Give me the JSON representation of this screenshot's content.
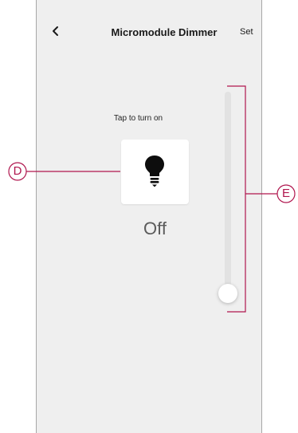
{
  "header": {
    "back_icon": "chevron-left-icon",
    "title": "Micromodule Dimmer",
    "set_label": "Set"
  },
  "control": {
    "hint": "Tap to turn on",
    "bulb_icon": "lightbulb-icon",
    "state": "Off"
  },
  "slider": {
    "level_percent": 0
  },
  "callouts": {
    "d": "D",
    "e": "E",
    "color": "#b0164e"
  }
}
